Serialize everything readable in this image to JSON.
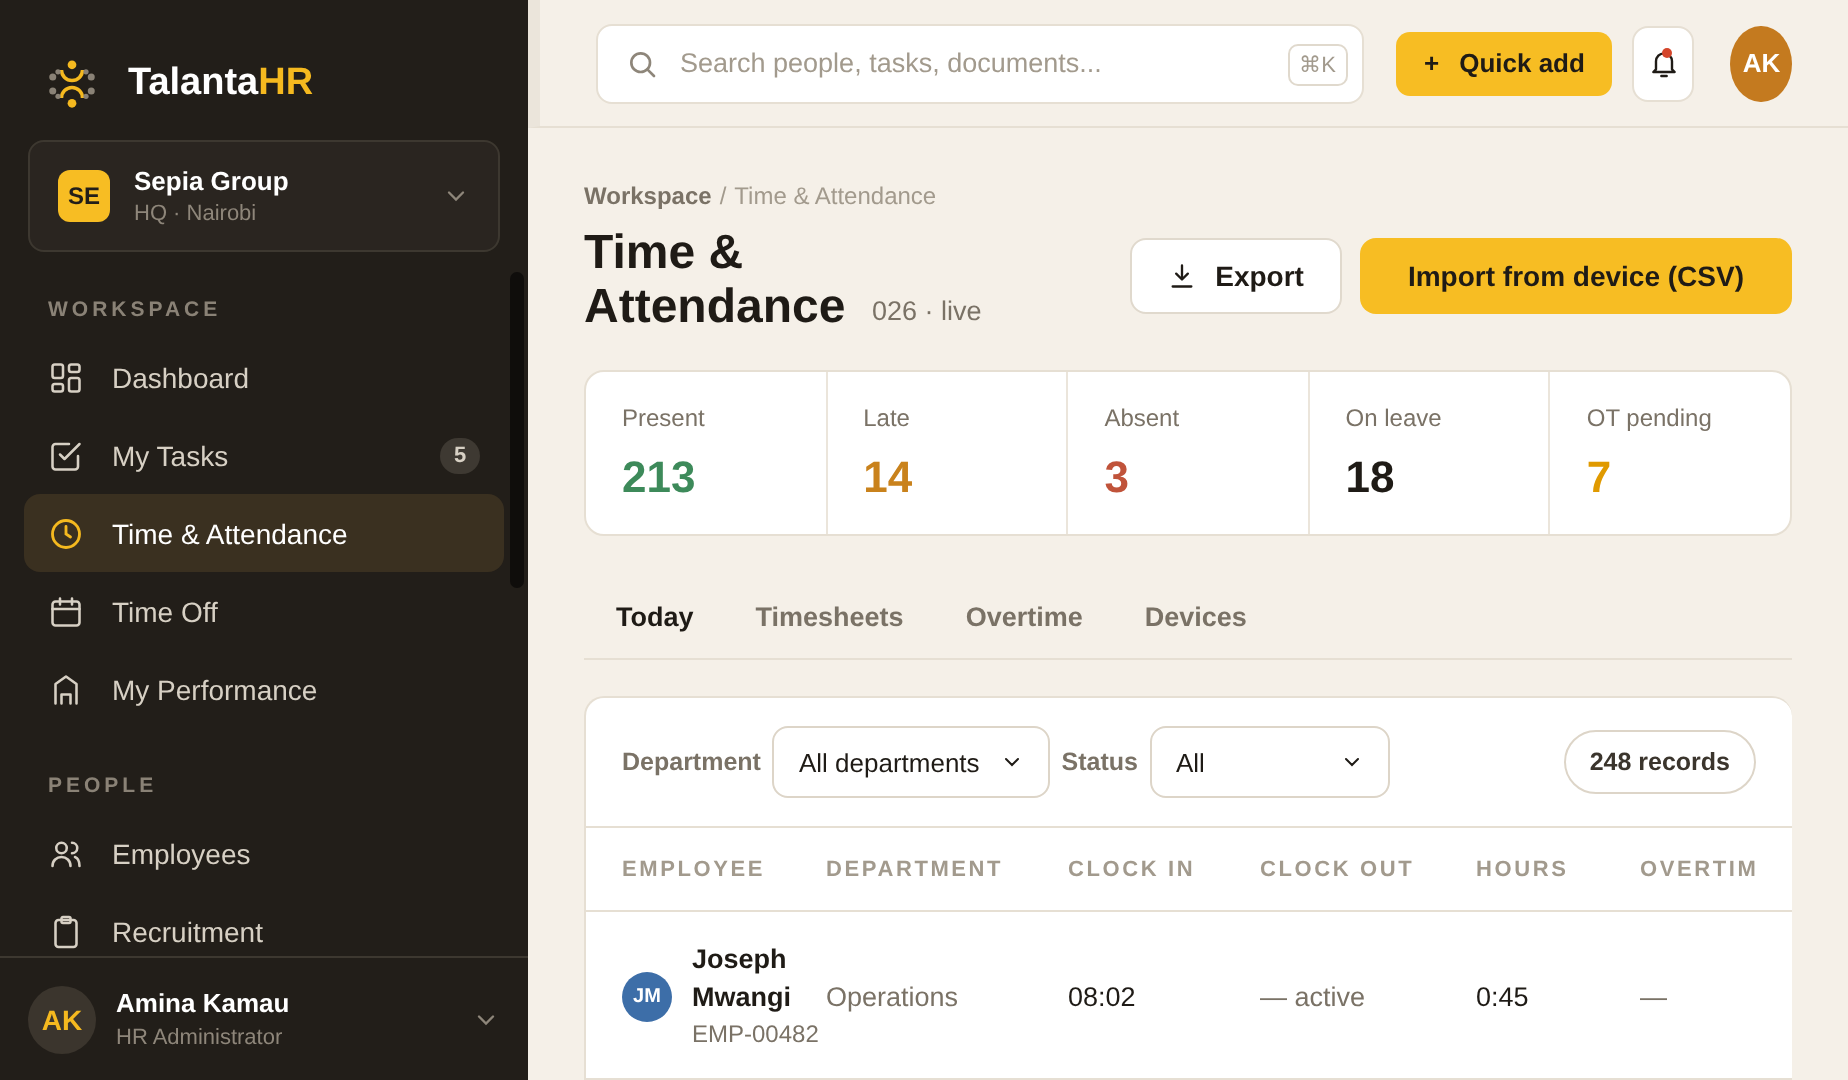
{
  "brand": {
    "name": "Talanta",
    "accent": "HR"
  },
  "org": {
    "initials": "SE",
    "name": "Sepia Group",
    "location": "HQ · Nairobi"
  },
  "nav_sections": [
    {
      "title": "WORKSPACE",
      "items": [
        {
          "label": "Dashboard",
          "selected": false
        },
        {
          "label": "My Tasks",
          "badge": "5",
          "selected": false
        },
        {
          "label": "Time & Attendance",
          "selected": true
        },
        {
          "label": "Time Off",
          "selected": false
        },
        {
          "label": "My Performance",
          "selected": false
        }
      ]
    },
    {
      "title": "PEOPLE",
      "items": [
        {
          "label": "Employees",
          "selected": false
        },
        {
          "label": "Recruitment",
          "selected": false
        }
      ]
    }
  ],
  "user": {
    "initials": "AK",
    "name": "Amina Kamau",
    "role": "HR Administrator"
  },
  "search": {
    "placeholder": "Search people, tasks, documents...",
    "shortcut": "⌘K"
  },
  "quick_add": {
    "icon": "+",
    "label": "Quick add"
  },
  "notifications": {
    "unread": true
  },
  "account": {
    "initials": "AK"
  },
  "breadcrumb": {
    "root": "Workspace",
    "separator": "/",
    "current": "Time & Attendance"
  },
  "page": {
    "title": "Time & Attendance",
    "subtitle": "026 · live"
  },
  "actions": [
    {
      "label": "Export",
      "kind": "secondary"
    },
    {
      "label": "Import from device (CSV)",
      "kind": "primary"
    }
  ],
  "stats": [
    {
      "label": "Present",
      "value": "213",
      "color": "#3d8a5a"
    },
    {
      "label": "Late",
      "value": "14",
      "color": "#c9821c"
    },
    {
      "label": "Absent",
      "value": "3",
      "color": "#c0533a"
    },
    {
      "label": "On leave",
      "value": "18",
      "color": "#1f1b16"
    },
    {
      "label": "OT pending",
      "value": "7",
      "color": "#e09a00"
    }
  ],
  "tabs": [
    {
      "label": "Today",
      "selected": true
    },
    {
      "label": "Timesheets",
      "selected": false
    },
    {
      "label": "Overtime",
      "selected": false
    },
    {
      "label": "Devices",
      "selected": false
    }
  ],
  "filters": [
    {
      "label": "Department",
      "value": "All departments"
    },
    {
      "label": "Status",
      "value": "All"
    }
  ],
  "record_count": "248 records",
  "table": {
    "columns": [
      "EMPLOYEE",
      "DEPARTMENT",
      "CLOCK IN",
      "CLOCK OUT",
      "HOURS",
      "OVERTIM"
    ],
    "rows": [
      {
        "initials": "JM",
        "name": "Joseph Mwangi",
        "id": "EMP-00482",
        "department": "Operations",
        "clock_in": "08:02",
        "clock_out": "— active",
        "hours": "0:45",
        "overtime": "—"
      }
    ]
  }
}
